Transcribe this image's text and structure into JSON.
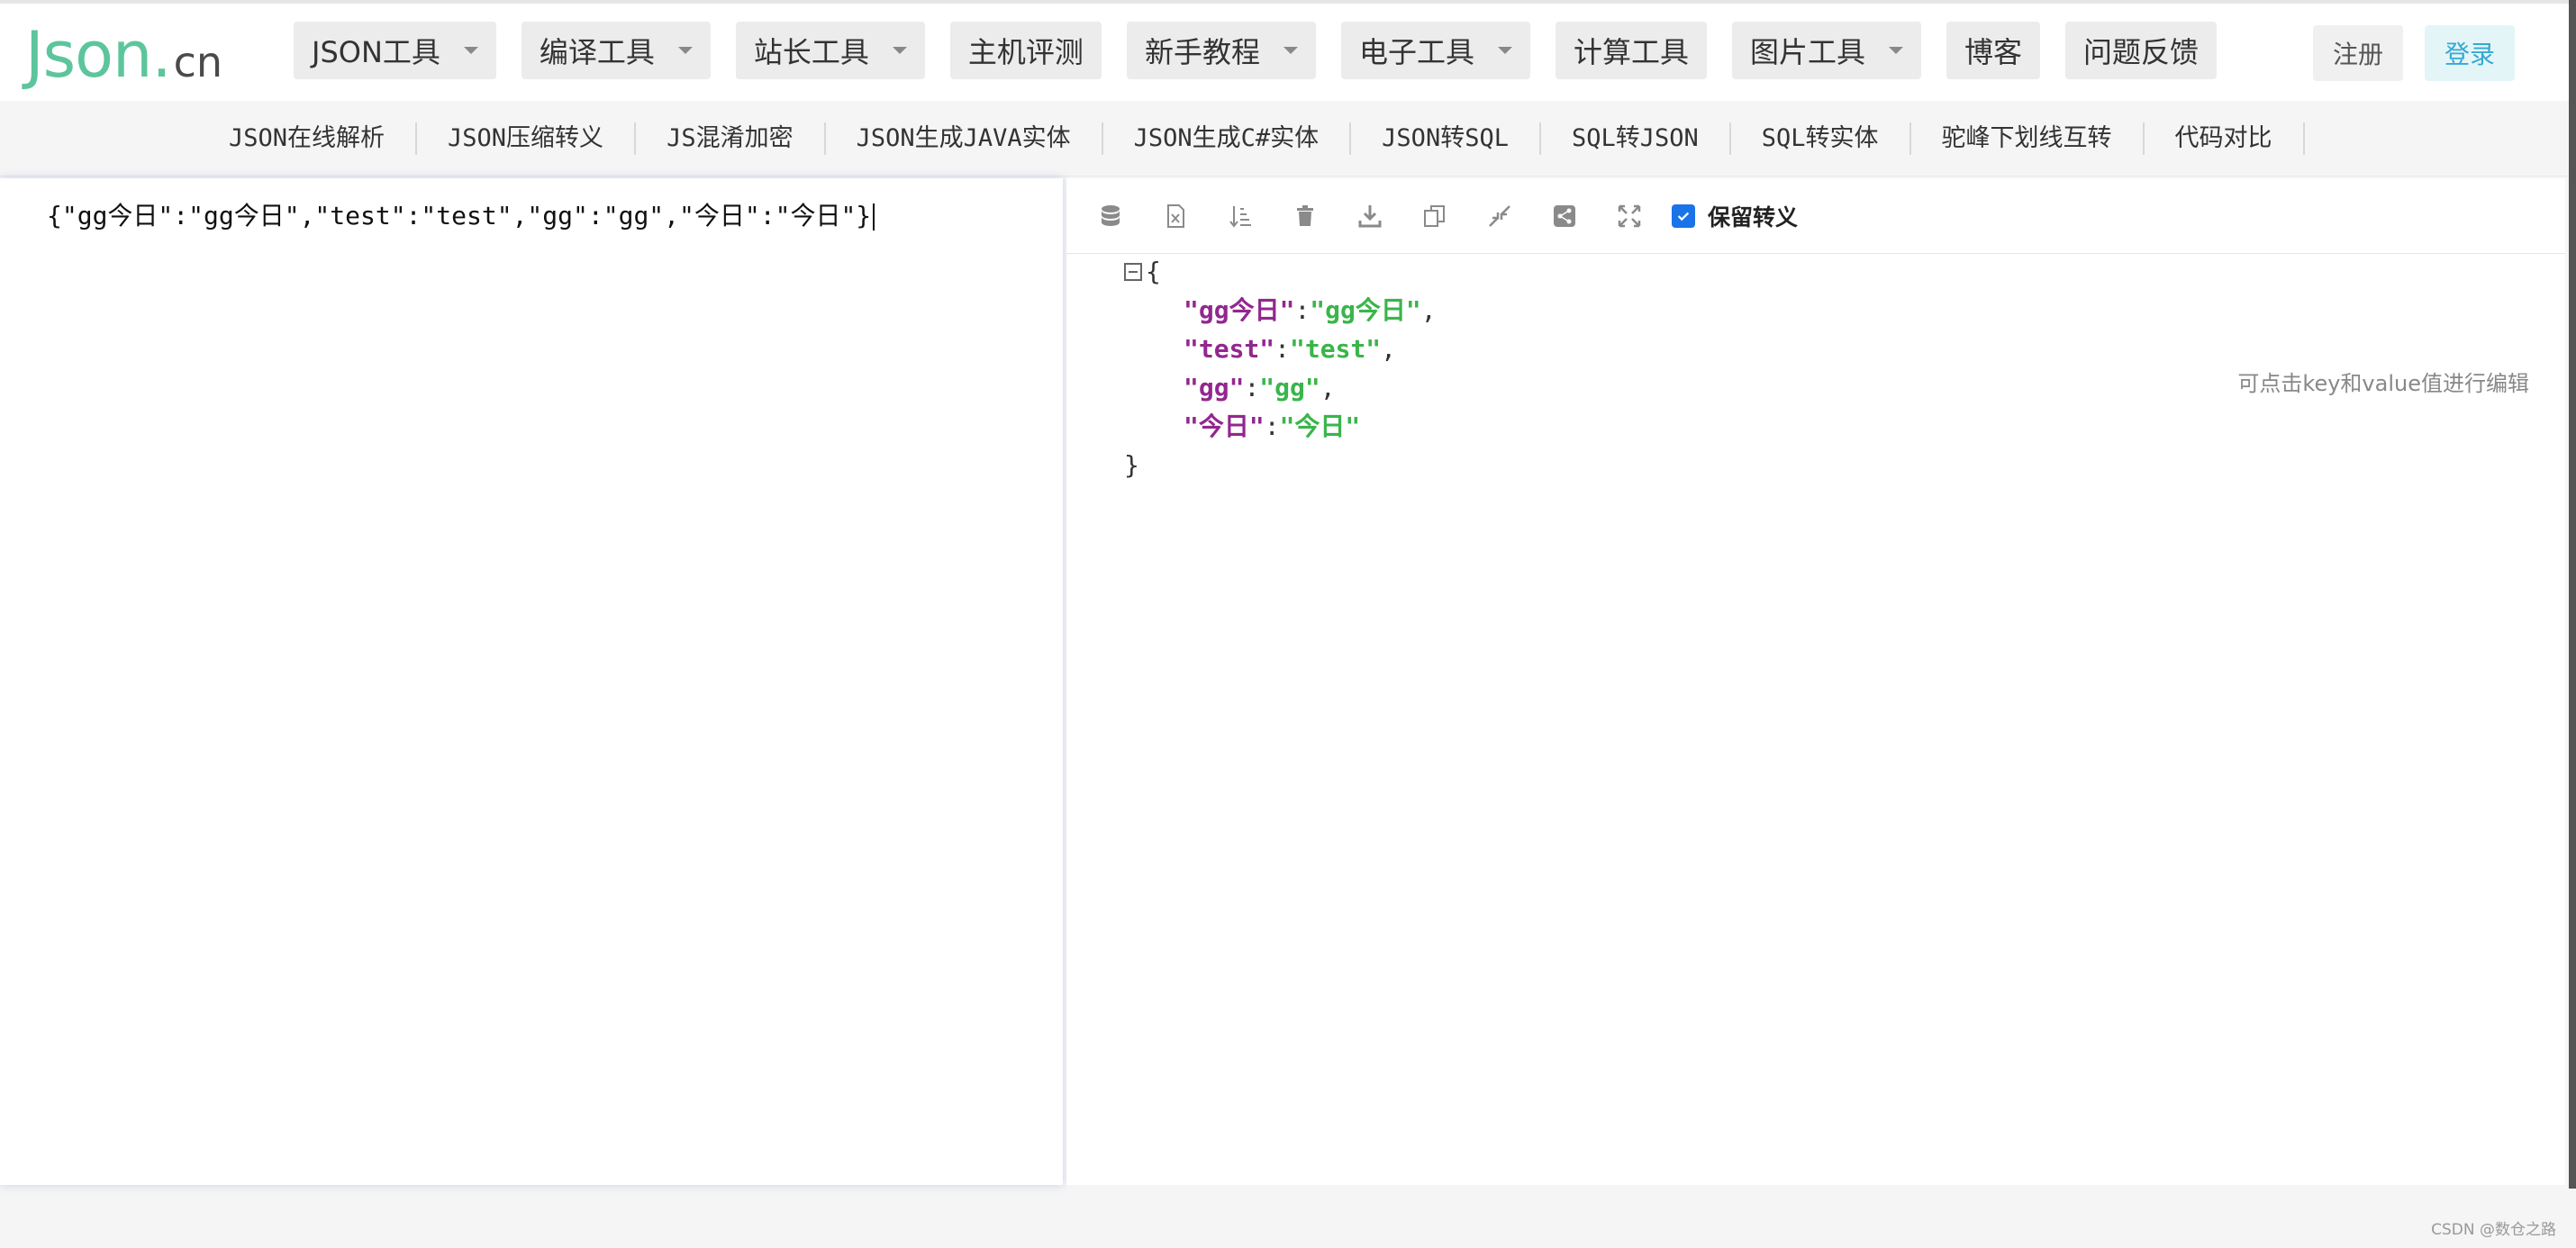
{
  "logo": {
    "main": "Json",
    "dot": ".",
    "tld": "cn"
  },
  "nav": {
    "items": [
      {
        "label": "JSON工具",
        "dropdown": true
      },
      {
        "label": "编译工具",
        "dropdown": true
      },
      {
        "label": "站长工具",
        "dropdown": true
      },
      {
        "label": "主机评测",
        "dropdown": false
      },
      {
        "label": "新手教程",
        "dropdown": true
      },
      {
        "label": "电子工具",
        "dropdown": true
      },
      {
        "label": "计算工具",
        "dropdown": false
      },
      {
        "label": "图片工具",
        "dropdown": true
      },
      {
        "label": "博客",
        "dropdown": false
      },
      {
        "label": "问题反馈",
        "dropdown": false
      }
    ],
    "register": "注册",
    "login": "登录"
  },
  "subnav": {
    "items": [
      "JSON在线解析",
      "JSON压缩转义",
      "JS混淆加密",
      "JSON生成JAVA实体",
      "JSON生成C#实体",
      "JSON转SQL",
      "SQL转JSON",
      "SQL转实体",
      "驼峰下划线互转",
      "代码对比"
    ]
  },
  "editor": {
    "text": "{\"gg今日\":\"gg今日\",\"test\":\"test\",\"gg\":\"gg\",\"今日\":\"今日\"}"
  },
  "toolbar": {
    "icons": [
      "database-icon",
      "excel-icon",
      "sort-icon",
      "trash-icon",
      "download-icon",
      "copy-icon",
      "compress-icon",
      "share-icon",
      "expand-icon"
    ],
    "keep_escape_label": "保留转义",
    "keep_escape_checked": true
  },
  "json_view": {
    "open": "{",
    "close": "}",
    "entries": [
      {
        "key": "\"gg今日\"",
        "value": "\"gg今日\"",
        "comma": ","
      },
      {
        "key": "\"test\"",
        "value": "\"test\"",
        "comma": ","
      },
      {
        "key": "\"gg\"",
        "value": "\"gg\"",
        "comma": ","
      },
      {
        "key": "\"今日\"",
        "value": "\"今日\"",
        "comma": ""
      }
    ],
    "edit_hint": "可点击key和value值进行编辑"
  },
  "footer": {
    "watermark": "CSDN @数仓之路"
  },
  "colors": {
    "brand": "#5cc59c",
    "key": "#92278f",
    "value": "#3ab54a",
    "accent": "#1a73e8"
  }
}
